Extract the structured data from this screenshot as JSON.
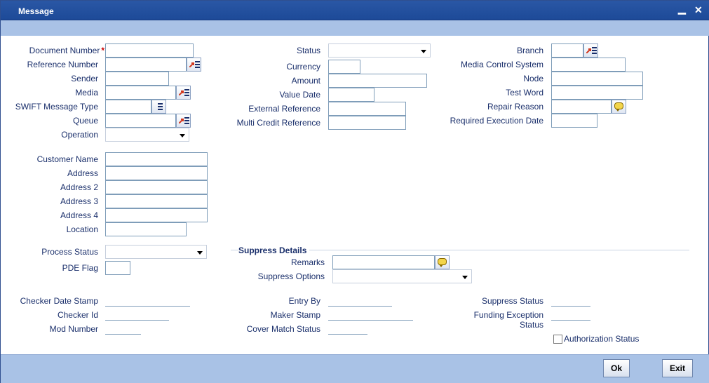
{
  "window": {
    "title": "Message",
    "minimize_glyph": "▁",
    "close_glyph": "✕"
  },
  "left": {
    "document_number": "Document Number",
    "reference_number": "Reference Number",
    "sender": "Sender",
    "media": "Media",
    "swift_message_type": "SWIFT Message Type",
    "queue": "Queue",
    "operation": "Operation",
    "customer_name": "Customer Name",
    "address": "Address",
    "address2": "Address 2",
    "address3": "Address 3",
    "address4": "Address 4",
    "location": "Location",
    "process_status": "Process Status",
    "pde_flag": "PDE Flag",
    "checker_date_stamp": "Checker Date Stamp",
    "checker_id": "Checker Id",
    "mod_number": "Mod Number"
  },
  "middle": {
    "status": "Status",
    "currency": "Currency",
    "amount": "Amount",
    "value_date": "Value Date",
    "external_reference": "External Reference",
    "multi_credit_reference": "Multi Credit Reference",
    "entry_by": "Entry By",
    "maker_stamp": "Maker Stamp",
    "cover_match_status": "Cover Match Status"
  },
  "right": {
    "branch": "Branch",
    "media_control_system": "Media Control System",
    "node": "Node",
    "test_word": "Test Word",
    "repair_reason": "Repair Reason",
    "required_execution_date": "Required Execution Date",
    "suppress_status": "Suppress Status",
    "funding_exception_status": "Funding Exception Status",
    "authorization_status": "Authorization Status"
  },
  "suppress": {
    "section_title": "Suppress Details",
    "remarks": "Remarks",
    "suppress_options": "Suppress Options"
  },
  "footer": {
    "ok": "Ok",
    "exit": "Exit"
  },
  "required_marker": "*",
  "icons": {
    "lov": "list-of-values-icon",
    "remarks": "speech-bubble-icon"
  },
  "colors": {
    "title_bar": "#1d4a98",
    "strip": "#a9c2e6",
    "label_text": "#1a2f6b",
    "required": "#cc0000"
  }
}
